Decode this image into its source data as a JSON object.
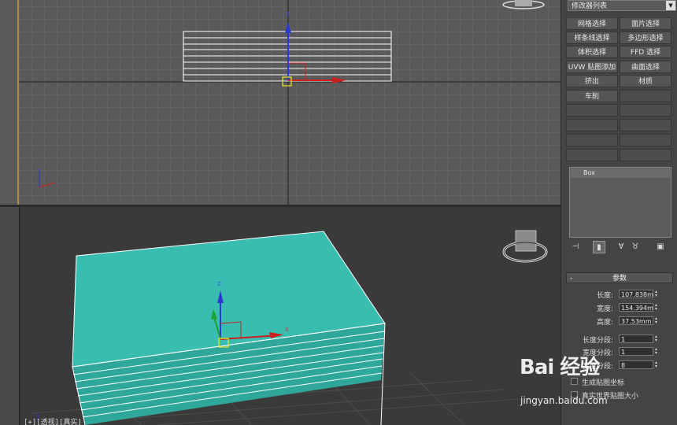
{
  "viewport_top": {
    "label": ""
  },
  "viewport_persp": {
    "label": "[+][透视][真实]"
  },
  "gizmo_axis": {
    "x": "X",
    "y": "Y",
    "z": "Z"
  },
  "modifier_list": {
    "value": "修改器列表"
  },
  "mod_buttons": [
    {
      "label": "网格选择"
    },
    {
      "label": "面片选择"
    },
    {
      "label": "样条线选择"
    },
    {
      "label": "多边形选择"
    },
    {
      "label": "体积选择"
    },
    {
      "label": "FFD 选择"
    },
    {
      "label": "UVW 贴图添加"
    },
    {
      "label": "曲面选择"
    },
    {
      "label": "挤出"
    },
    {
      "label": "材质"
    },
    {
      "label": "车削"
    },
    {
      "label": ""
    }
  ],
  "stack": {
    "item": "Box"
  },
  "rollout": {
    "title": "参数",
    "collapse": "-"
  },
  "params": {
    "length_label": "长度:",
    "length_value": "107.838m",
    "width_label": "宽度:",
    "width_value": "154.394m",
    "height_label": "高度:",
    "height_value": "37.53mm",
    "length_seg_label": "长度分段:",
    "length_seg_value": "1",
    "width_seg_label": "宽度分段:",
    "width_seg_value": "1",
    "height_seg_label": "高度分段:",
    "height_seg_value": "8",
    "gen_map_label": "生成贴图坐标",
    "real_world_label": "真实世界贴图大小"
  },
  "watermark": {
    "brand": "Bai 经验",
    "url": "jingyan.baidu.com"
  },
  "colors": {
    "box": "#35b8ac",
    "grid": "#6b6b6b",
    "panel": "#444444"
  }
}
